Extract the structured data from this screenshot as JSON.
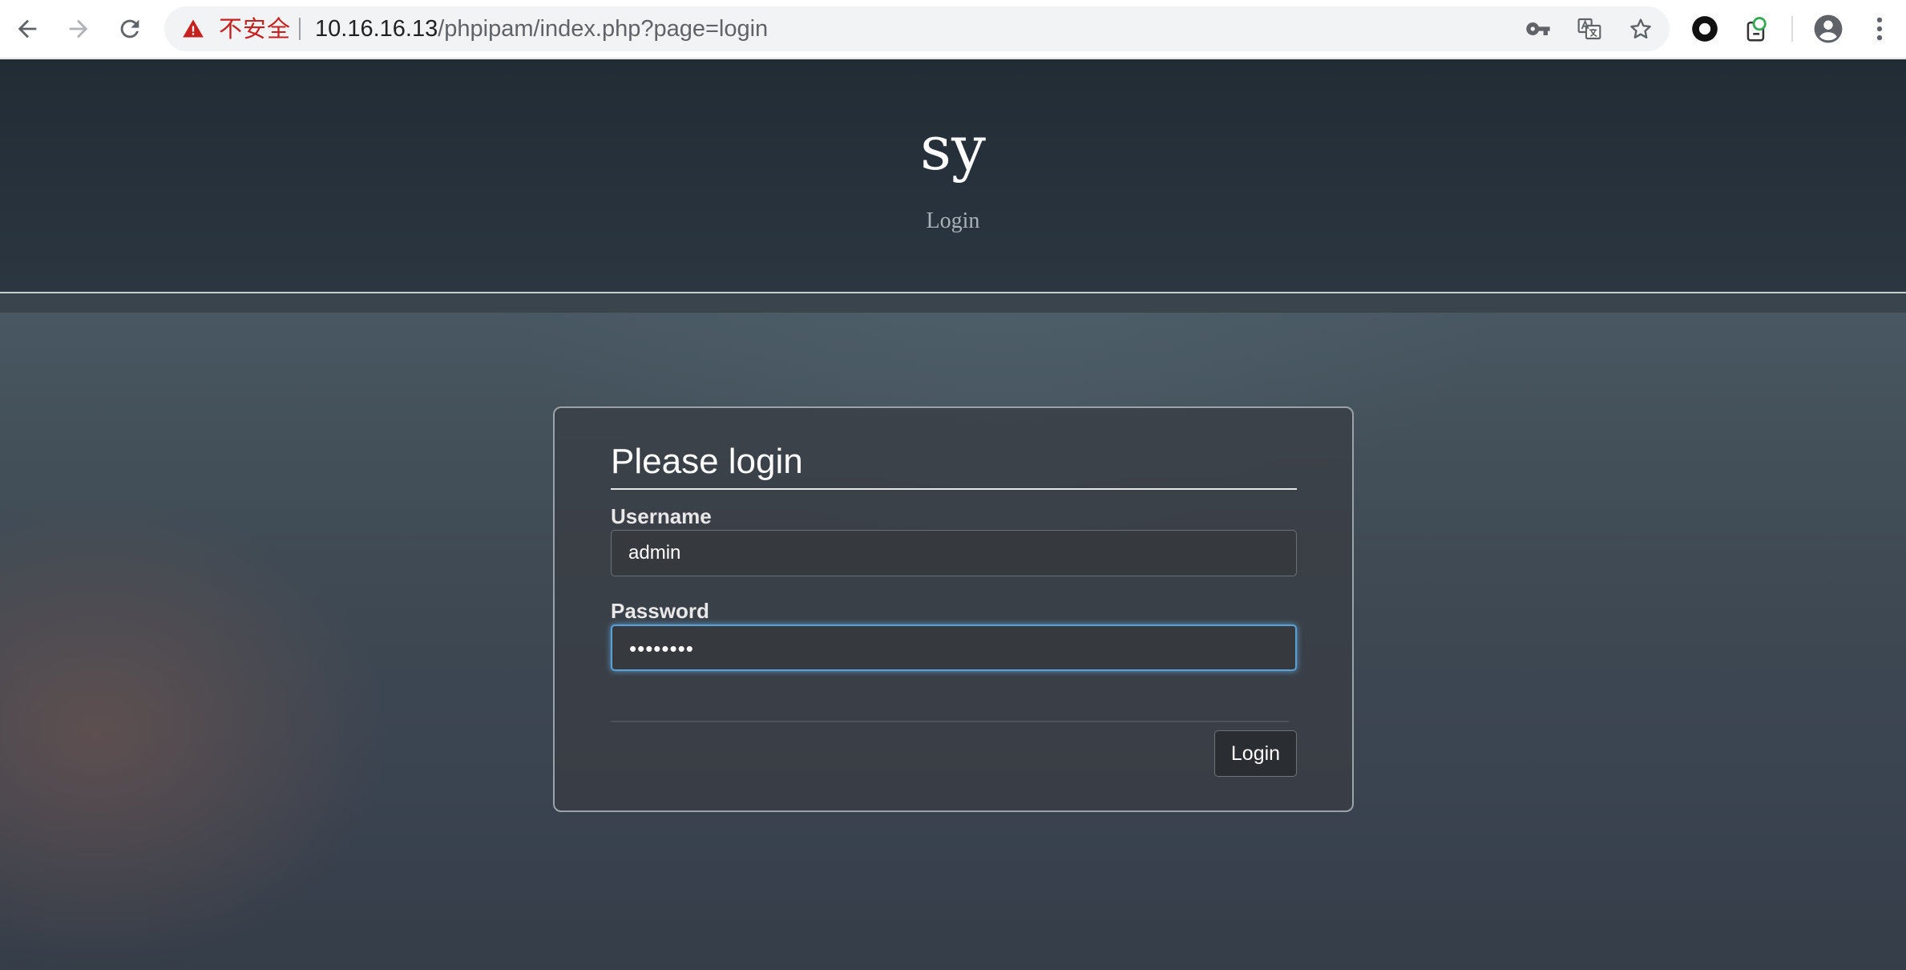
{
  "browser": {
    "security_label": "不安全",
    "url_host": "10.16.16.13",
    "url_path": "/phpipam/index.php?page=login",
    "icons": {
      "back": "back-arrow-icon",
      "forward": "forward-arrow-icon",
      "reload": "reload-icon",
      "warning": "warning-triangle-icon",
      "key": "key-icon",
      "translate": "translate-icon",
      "bookmark": "star-icon",
      "extension_1": "record-icon",
      "extension_2": "extension-icon",
      "profile": "profile-icon",
      "menu": "kebab-menu-icon"
    },
    "colors": {
      "insecure": "#c5221f"
    }
  },
  "header": {
    "site_title": "sy",
    "site_subtitle": "Login"
  },
  "login_form": {
    "heading": "Please login",
    "username_label": "Username",
    "username_value": "admin",
    "password_label": "Password",
    "password_value": "••••••••",
    "submit_label": "Login",
    "colors": {
      "focus_ring": "#5aa2d6"
    }
  }
}
